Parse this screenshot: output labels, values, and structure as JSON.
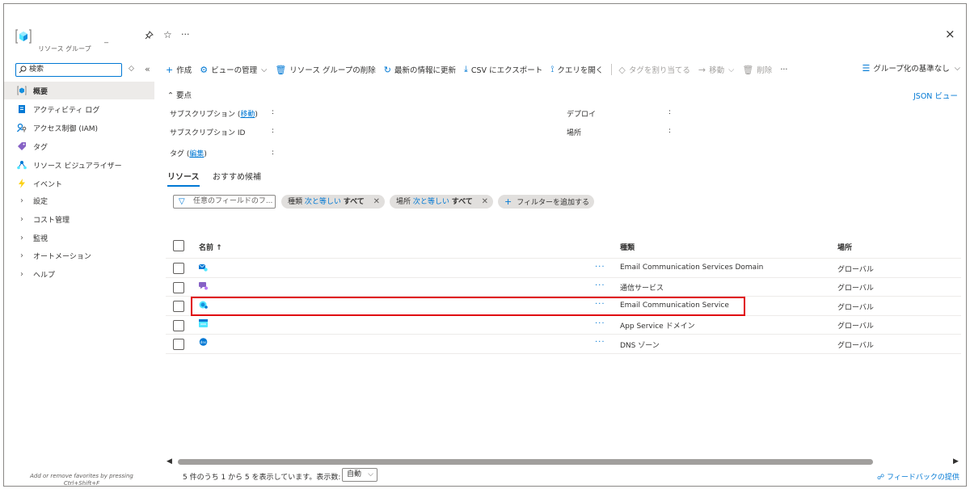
{
  "sidebar": {
    "resource_type": "リソース グループ",
    "dash": "_",
    "search_placeholder": "検索",
    "items": [
      {
        "label": "概要"
      },
      {
        "label": "アクティビティ ログ"
      },
      {
        "label": "アクセス制御 (IAM)"
      },
      {
        "label": "タグ"
      },
      {
        "label": "リソース ビジュアライザー"
      },
      {
        "label": "イベント"
      },
      {
        "label": "設定"
      },
      {
        "label": "コスト管理"
      },
      {
        "label": "監視"
      },
      {
        "label": "オートメーション"
      },
      {
        "label": "ヘルプ"
      }
    ],
    "footer_line1": "Add or remove favorites by pressing",
    "footer_line2": "Ctrl+Shift+F"
  },
  "topbar": {
    "more": "···",
    "close": "×"
  },
  "toolbar": {
    "create": "作成",
    "manage_view": "ビューの管理",
    "delete_group": "リソース グループの削除",
    "refresh": "最新の情報に更新",
    "export_csv": "CSV にエクスポート",
    "open_query": "クエリを開く",
    "assign_tags": "タグを割り当てる",
    "move": "移動",
    "delete": "削除",
    "more": "···",
    "group_by": "グループ化の基準なし"
  },
  "essentials": {
    "toggle": "要点",
    "json_view": "JSON ビュー",
    "subscription_label": "サブスクリプション (",
    "subscription_move": "移動",
    "subscription_label_end": ")",
    "subscription_id_label": "サブスクリプション ID",
    "deploy_label": "デプロイ",
    "location_label": "場所",
    "tags_label": "タグ (",
    "tags_edit": "編集",
    "tags_label_end": ")",
    "colon": ":"
  },
  "tabs": [
    {
      "label": "リソース"
    },
    {
      "label": "おすすめ候補"
    }
  ],
  "filters": {
    "placeholder": "任意のフィールドのフ...",
    "pill_type_prefix": "種類",
    "pill_type_op": "次と等しい",
    "pill_type_value": "すべて",
    "pill_loc_prefix": "場所",
    "pill_loc_op": "次と等しい",
    "pill_loc_value": "すべて",
    "add_filter": "フィルターを追加する"
  },
  "table": {
    "headers": {
      "name": "名前 ↑",
      "type": "種類",
      "location": "場所"
    },
    "rows": [
      {
        "type": "Email Communication Services Domain",
        "location": "グローバル"
      },
      {
        "type": "通信サービス",
        "location": "グローバル"
      },
      {
        "type": "Email Communication Service",
        "location": "グローバル"
      },
      {
        "type": "App Service ドメイン",
        "location": "グローバル"
      },
      {
        "type": "DNS ゾーン",
        "location": "グローバル"
      }
    ],
    "row_actions": "···"
  },
  "footer": {
    "showing": "5 件のうち 1 から 5 を表示しています。表示数:",
    "page_size": "自動",
    "feedback": "フィードバックの提供"
  },
  "colors": {
    "accent": "#0078d4",
    "highlight": "#e0000b"
  }
}
